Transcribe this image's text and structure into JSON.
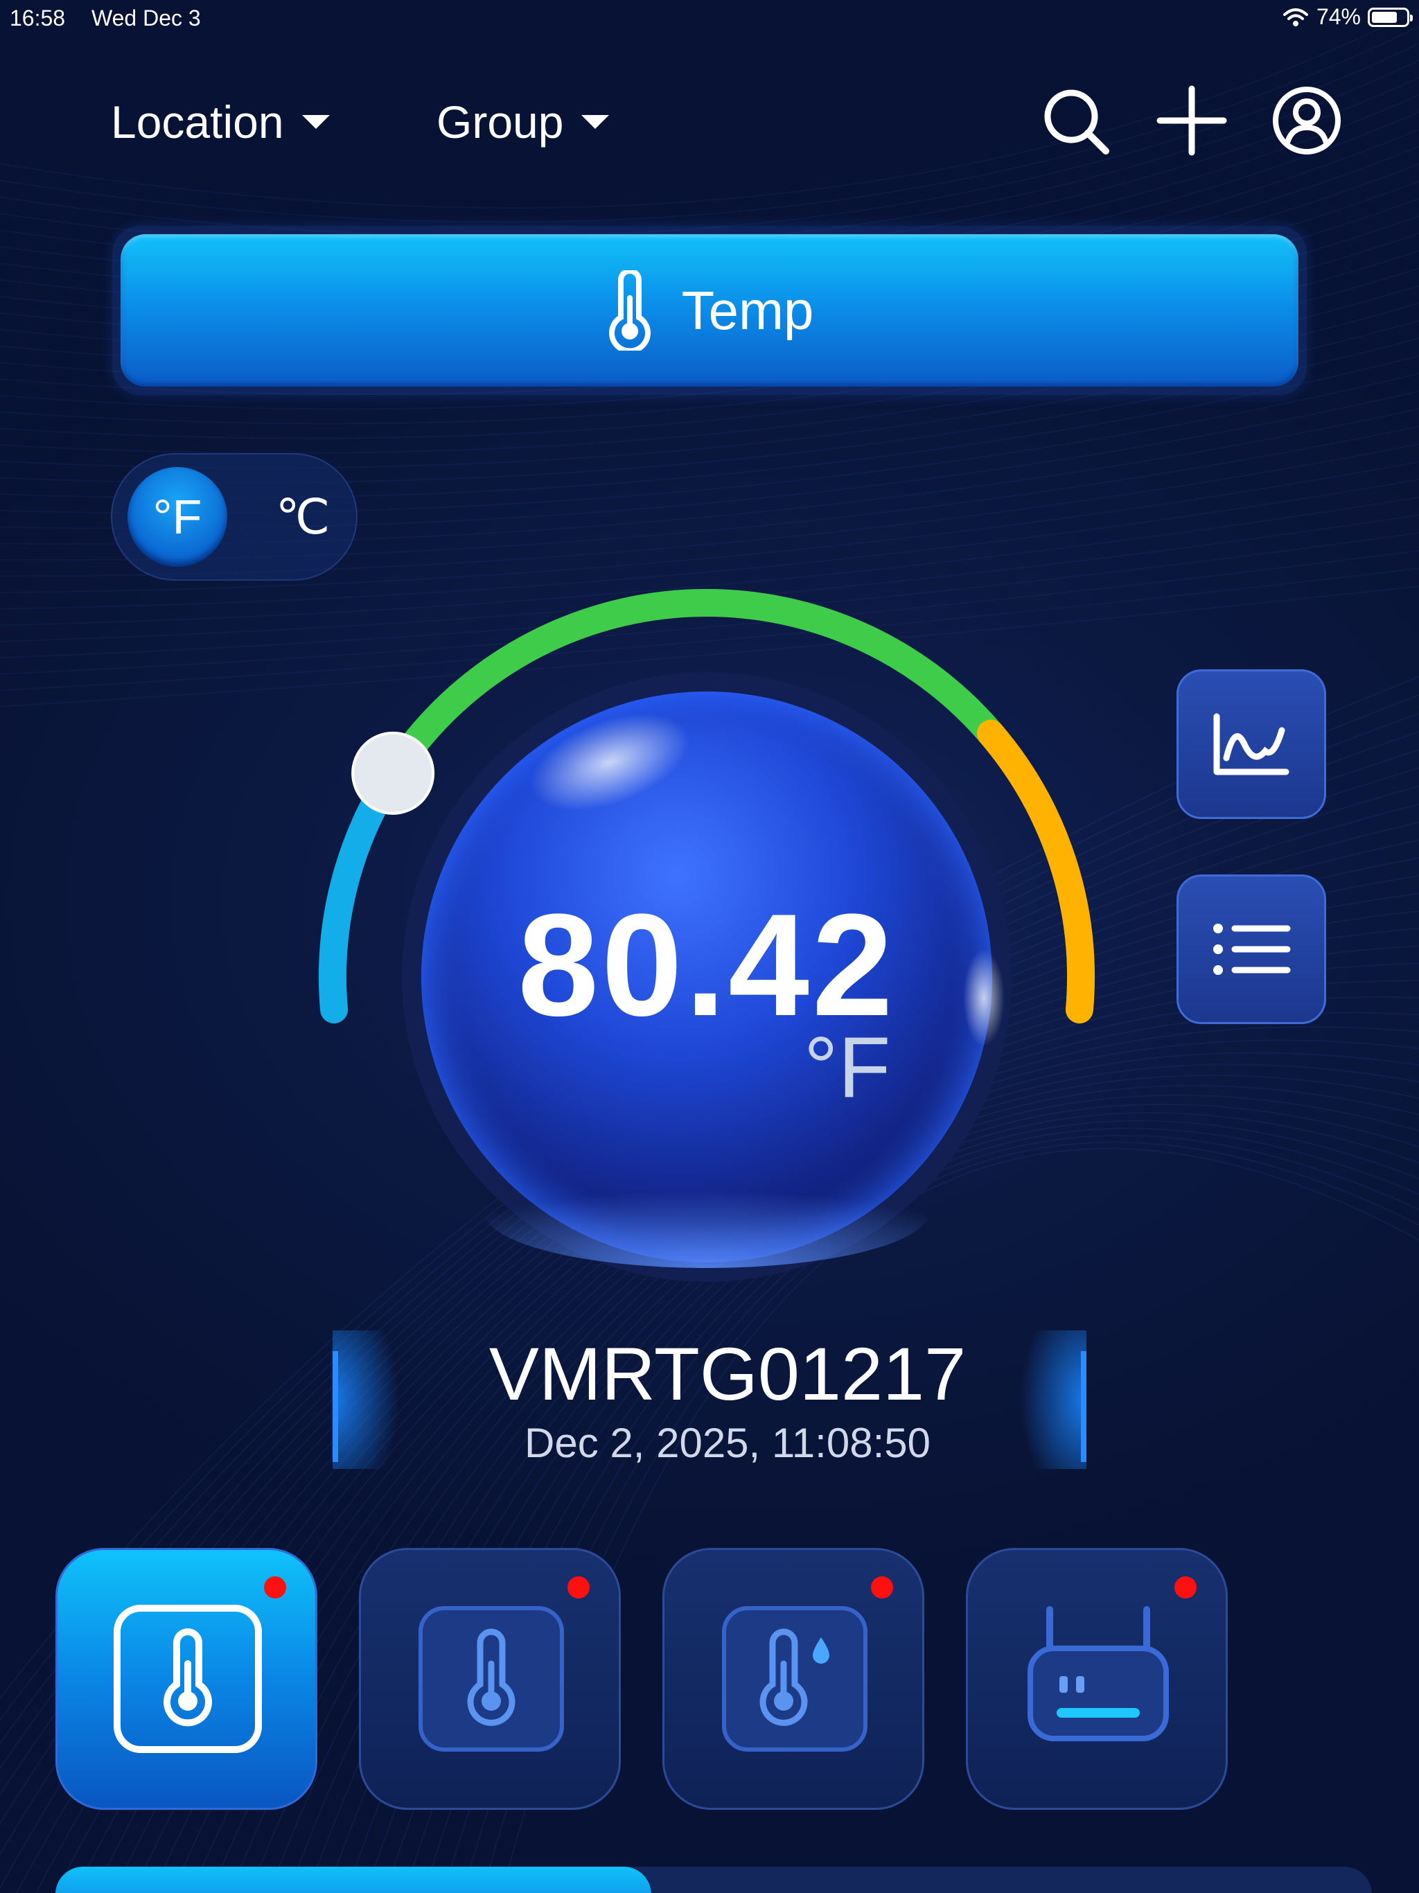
{
  "status_bar": {
    "time": "16:58",
    "date": "Wed Dec 3",
    "battery_percent": "74%",
    "battery_level": 0.74,
    "wifi_icon": "wifi-icon"
  },
  "nav": {
    "location_label": "Location",
    "group_label": "Group",
    "icons": [
      "search-icon",
      "plus-icon",
      "user-icon"
    ]
  },
  "banner": {
    "label": "Temp",
    "icon": "thermometer-icon"
  },
  "unit_toggle": {
    "fahrenheit": "°F",
    "celsius": "℃",
    "selected": "°F"
  },
  "reading": {
    "value": "80.42",
    "unit": "°F",
    "gauge_level": 0.2
  },
  "side_buttons": {
    "chart_icon": "line-chart-icon",
    "list_icon": "list-icon"
  },
  "device": {
    "id": "VMRTG01217",
    "timestamp": "Dec 2, 2025, 11:08:50"
  },
  "device_tabs": [
    {
      "icon": "thermometer-icon",
      "active": true,
      "alert": true
    },
    {
      "icon": "thermometer-icon",
      "active": false,
      "alert": true
    },
    {
      "icon": "thermometer-humidity-icon",
      "active": false,
      "alert": true
    },
    {
      "icon": "gateway-router-icon",
      "active": false,
      "alert": true
    }
  ],
  "colors": {
    "background": "#0a1436",
    "accent": "#0b8be8",
    "gauge_cold": "#13aeea",
    "gauge_normal": "#3ecc4a",
    "gauge_warm": "#ffb300",
    "alert": "#ff1010"
  }
}
